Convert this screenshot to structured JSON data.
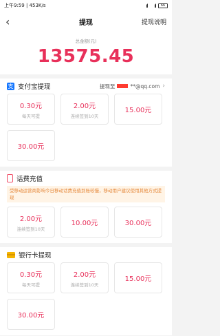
{
  "status": {
    "time": "上午9:59",
    "speed": "453K/s",
    "battery": "66"
  },
  "nav": {
    "title": "提现",
    "right": "提现说明"
  },
  "balance": {
    "label": "总金额(元)",
    "value": "13575.45"
  },
  "alipay": {
    "title": "支付宝提现",
    "to_label": "提现至",
    "account_suffix": "**@qq.com",
    "options": [
      {
        "amount": "0.30元",
        "note": "每天可提"
      },
      {
        "amount": "2.00元",
        "note": "连续签到10天"
      },
      {
        "amount": "15.00元",
        "note": ""
      },
      {
        "amount": "30.00元",
        "note": ""
      }
    ]
  },
  "phone": {
    "title": "话费充值",
    "notice": "受移动运营商影响今日移动话费充值到账较慢，移动用户建议使用其他方式提现",
    "options": [
      {
        "amount": "2.00元",
        "note": "连续签到10天"
      },
      {
        "amount": "10.00元",
        "note": ""
      },
      {
        "amount": "30.00元",
        "note": ""
      }
    ]
  },
  "bank": {
    "title": "银行卡提现",
    "options": [
      {
        "amount": "0.30元",
        "note": "每天可提"
      },
      {
        "amount": "2.00元",
        "note": "连续签到10天"
      },
      {
        "amount": "15.00元",
        "note": ""
      },
      {
        "amount": "30.00元",
        "note": ""
      }
    ]
  },
  "colors": {
    "accent": "#e8305a",
    "alipay": "#1677ff",
    "card": "#f5b400"
  }
}
